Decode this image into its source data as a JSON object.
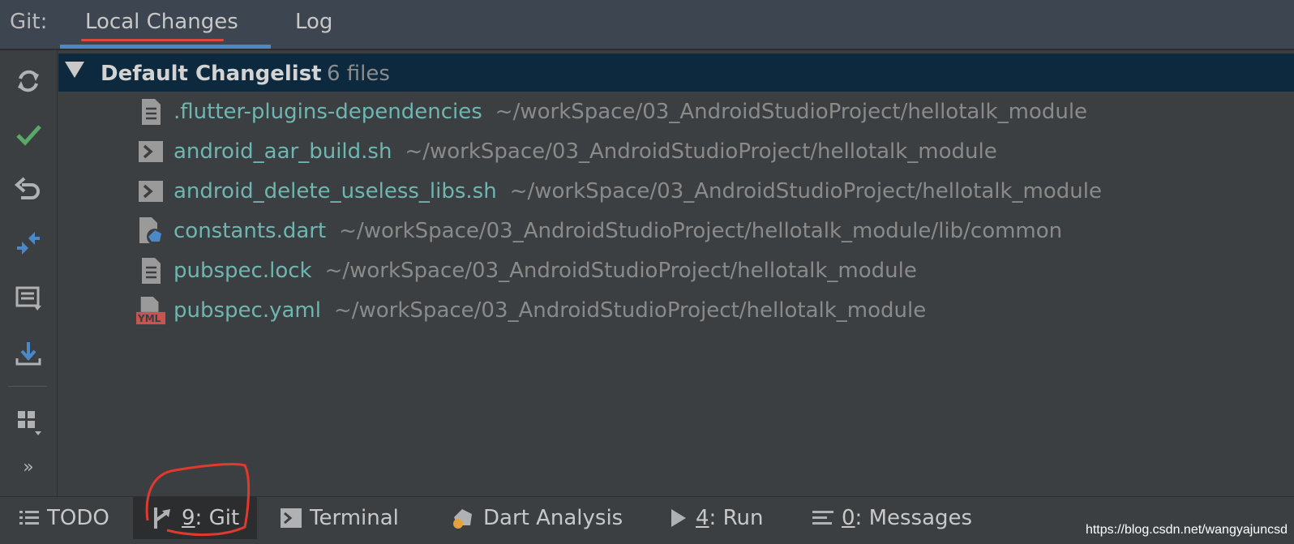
{
  "header": {
    "prefix": "Git:",
    "tabs": [
      {
        "label": "Local Changes",
        "active": true
      },
      {
        "label": "Log",
        "active": false
      }
    ]
  },
  "toolbar": {
    "buttons": [
      "refresh-icon",
      "commit-check-icon",
      "rollback-icon",
      "diff-icon",
      "commit-message-icon",
      "shelve-download-icon",
      "group-by-icon",
      "more-icon"
    ],
    "more_label": "»"
  },
  "changelist": {
    "name": "Default Changelist",
    "count": "6 files",
    "files": [
      {
        "name": ".flutter-plugins-dependencies",
        "path": "~/workSpace/03_AndroidStudioProject/hellotalk_module",
        "icon": "text-file-icon"
      },
      {
        "name": "android_aar_build.sh",
        "path": "~/workSpace/03_AndroidStudioProject/hellotalk_module",
        "icon": "shell-script-icon"
      },
      {
        "name": "android_delete_useless_libs.sh",
        "path": "~/workSpace/03_AndroidStudioProject/hellotalk_module",
        "icon": "shell-script-icon"
      },
      {
        "name": "constants.dart",
        "path": "~/workSpace/03_AndroidStudioProject/hellotalk_module/lib/common",
        "icon": "dart-file-icon"
      },
      {
        "name": "pubspec.lock",
        "path": "~/workSpace/03_AndroidStudioProject/hellotalk_module",
        "icon": "text-file-icon"
      },
      {
        "name": "pubspec.yaml",
        "path": "~/workSpace/03_AndroidStudioProject/hellotalk_module",
        "icon": "yaml-file-icon"
      }
    ],
    "yml_badge": "YML"
  },
  "bottombar": {
    "todo": "TODO",
    "git_num": "9",
    "git_rest": ": Git",
    "terminal": "Terminal",
    "dart_analysis": "Dart Analysis",
    "run_num": "4",
    "run_rest": ": Run",
    "messages_num": "0",
    "messages_rest": ": Messages"
  },
  "watermark": "https://blog.csdn.net/wangyajuncsd",
  "colors": {
    "accent_blue": "#4a88c7",
    "active_tab_red": "#e0483e",
    "selected_row": "#0d293e",
    "file_name": "#6fb6b1",
    "commit_green": "#59a869"
  }
}
